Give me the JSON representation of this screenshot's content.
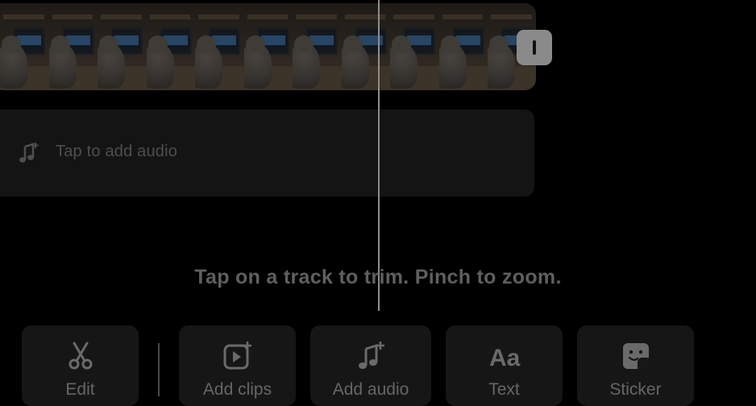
{
  "timeline": {
    "frame_count": 11
  },
  "audio_track": {
    "icon": "music-note-plus-icon",
    "label": "Tap to add audio"
  },
  "hint": "Tap on a track to trim. Pinch to zoom.",
  "toolbar": {
    "edit": {
      "label": "Edit",
      "icon": "scissors-icon"
    },
    "add_clips": {
      "label": "Add clips",
      "icon": "video-add-icon"
    },
    "add_audio": {
      "label": "Add audio",
      "icon": "music-note-plus-icon"
    },
    "text": {
      "label": "Text",
      "icon": "text-aa-icon"
    },
    "sticker": {
      "label": "Sticker",
      "icon": "sticker-icon"
    }
  },
  "colors": {
    "background": "#000000",
    "button_bg": "#161616",
    "audio_track_bg": "#141414",
    "text_muted": "#666666"
  }
}
